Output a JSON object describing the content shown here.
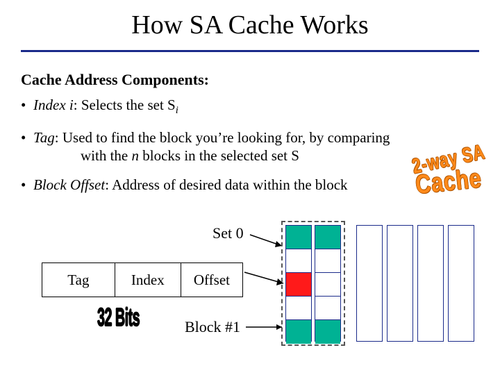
{
  "title": "How SA Cache Works",
  "subtitle": "Cache Address Components:",
  "bullets": {
    "index": {
      "term": "Index i",
      "rest": ": Selects the set S",
      "sub": "i"
    },
    "tag": {
      "term": "Tag",
      "rest_line1": ": Used to find the block you’re looking for, by comparing",
      "rest_line2_pre": "with the ",
      "rest_line2_em": "n",
      "rest_line2_post": " blocks in the selected set S"
    },
    "offset": {
      "term": "Block Offset",
      "rest": ": Address of desired data within the block"
    }
  },
  "addr_fields": {
    "tag": "Tag",
    "index": "Index",
    "offset": "Offset"
  },
  "labels": {
    "set0": "Set 0",
    "block1": "Block #1"
  },
  "wordart": {
    "bits": "32 Bits",
    "sa_line1": "2-way SA",
    "sa_line2": "Cache"
  },
  "colors": {
    "rule": "#1a2a8a",
    "green": "#00b294",
    "red": "#ff1a1a",
    "orange": "#ff8a1a"
  }
}
